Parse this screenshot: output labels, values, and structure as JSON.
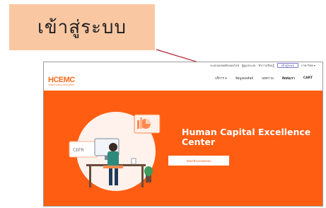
{
  "callout": {
    "text": "เข้าสู่ระบบ"
  },
  "topbar": {
    "text1": "ระบบจองหอพักออนไลน์",
    "text2": "ผู้ดูแลระบบ",
    "text3": "ทำการเรียนรู้",
    "button": "เข้าสู่ระบบ",
    "lang": "ภาษาไทย ▾"
  },
  "navbar": {
    "logo": "HCEMC",
    "logo_sub": "HUMAN CAPITAL EXCELLENCE",
    "items": [
      "บริการ ▾",
      "ข้อมูลผลลัพธ์",
      "บทความ",
      "ติดต่อเรา",
      "CART"
    ]
  },
  "hero": {
    "title": "Human Capital Excellence Center",
    "button": "สมัครทำแบบทดสอบ",
    "illustration_label": "CEFR"
  },
  "colors": {
    "accent": "#ff5d12",
    "callout_bg": "#f9c8a3",
    "pointer": "#b0212a"
  }
}
